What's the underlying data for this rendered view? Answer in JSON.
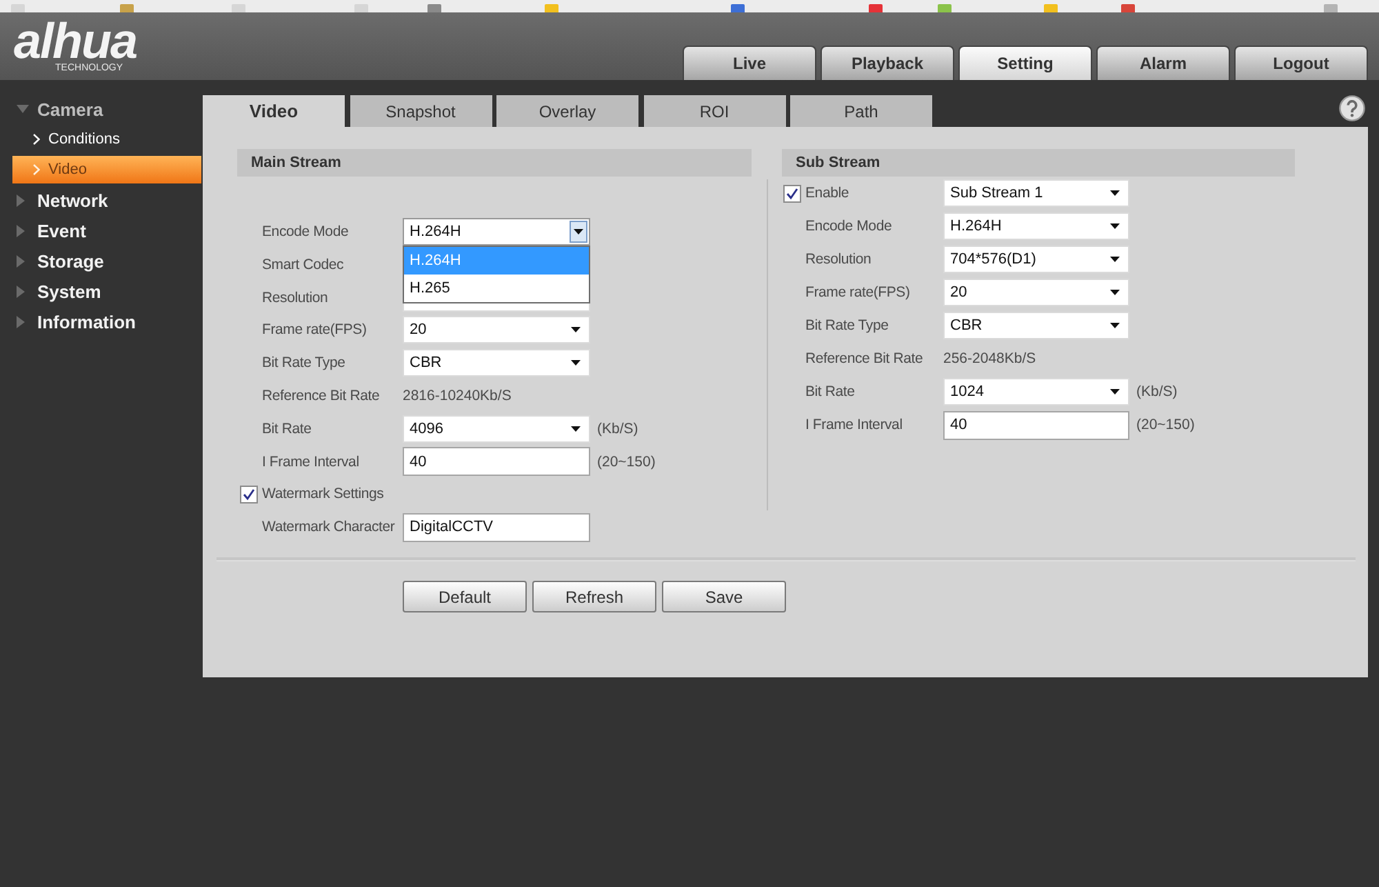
{
  "header": {
    "logo": "alhua",
    "logo_subtitle": "TECHNOLOGY",
    "nav": [
      {
        "label": "Live",
        "selected": false
      },
      {
        "label": "Playback",
        "selected": false
      },
      {
        "label": "Setting",
        "selected": true
      },
      {
        "label": "Alarm",
        "selected": false
      },
      {
        "label": "Logout",
        "selected": false
      }
    ]
  },
  "sidebar": {
    "items": [
      {
        "label": "Camera",
        "expanded": true,
        "children": [
          {
            "label": "Conditions",
            "selected": false
          },
          {
            "label": "Video",
            "selected": true
          }
        ]
      },
      {
        "label": "Network",
        "expanded": false
      },
      {
        "label": "Event",
        "expanded": false
      },
      {
        "label": "Storage",
        "expanded": false
      },
      {
        "label": "System",
        "expanded": false
      },
      {
        "label": "Information",
        "expanded": false
      }
    ]
  },
  "tabs": [
    {
      "label": "Video",
      "selected": true
    },
    {
      "label": "Snapshot",
      "selected": false
    },
    {
      "label": "Overlay",
      "selected": false
    },
    {
      "label": "ROI",
      "selected": false
    },
    {
      "label": "Path",
      "selected": false
    }
  ],
  "main_stream": {
    "title": "Main Stream",
    "rows": [
      {
        "kind": "select",
        "label": "Encode Mode",
        "value": "H.264H",
        "expanded": true,
        "options": [
          {
            "label": "H.264H",
            "selected": true
          },
          {
            "label": "H.265",
            "selected": false
          }
        ]
      },
      {
        "kind": "label",
        "label": "Smart Codec"
      },
      {
        "kind": "select",
        "label": "Resolution",
        "expanded": false
      },
      {
        "kind": "select",
        "label": "Frame rate(FPS)",
        "value": "20",
        "expanded": false
      },
      {
        "kind": "select",
        "label": "Bit Rate Type",
        "value": "CBR",
        "expanded": false
      },
      {
        "kind": "text",
        "label": "Reference Bit Rate",
        "value": "2816-10240Kb/S"
      },
      {
        "kind": "select",
        "label": "Bit Rate",
        "value": "4096",
        "expanded": false,
        "unit": "(Kb/S)"
      },
      {
        "kind": "input",
        "label": "I Frame Interval",
        "value": "40",
        "unit": "(20~150)"
      },
      {
        "kind": "checkbox",
        "label": "Watermark Settings",
        "checked": true
      },
      {
        "kind": "input",
        "label": "Watermark Character",
        "value": "DigitalCCTV"
      }
    ]
  },
  "sub_stream": {
    "title": "Sub Stream",
    "rows": [
      {
        "kind": "checkbox_select",
        "label": "Enable",
        "checked": true,
        "value": "Sub Stream 1",
        "expanded": false
      },
      {
        "kind": "select",
        "label": "Encode Mode",
        "value": "H.264H",
        "expanded": false
      },
      {
        "kind": "select",
        "label": "Resolution",
        "value": "704*576(D1)",
        "expanded": false
      },
      {
        "kind": "select",
        "label": "Frame rate(FPS)",
        "value": "20",
        "expanded": false
      },
      {
        "kind": "select",
        "label": "Bit Rate Type",
        "value": "CBR",
        "expanded": false
      },
      {
        "kind": "text",
        "label": "Reference Bit Rate",
        "value": "256-2048Kb/S"
      },
      {
        "kind": "select",
        "label": "Bit Rate",
        "value": "1024",
        "expanded": false,
        "unit": "(Kb/S)"
      },
      {
        "kind": "input",
        "label": "I Frame Interval",
        "value": "40",
        "unit": "(20~150)"
      }
    ]
  },
  "buttons": [
    "Default",
    "Refresh",
    "Save"
  ]
}
